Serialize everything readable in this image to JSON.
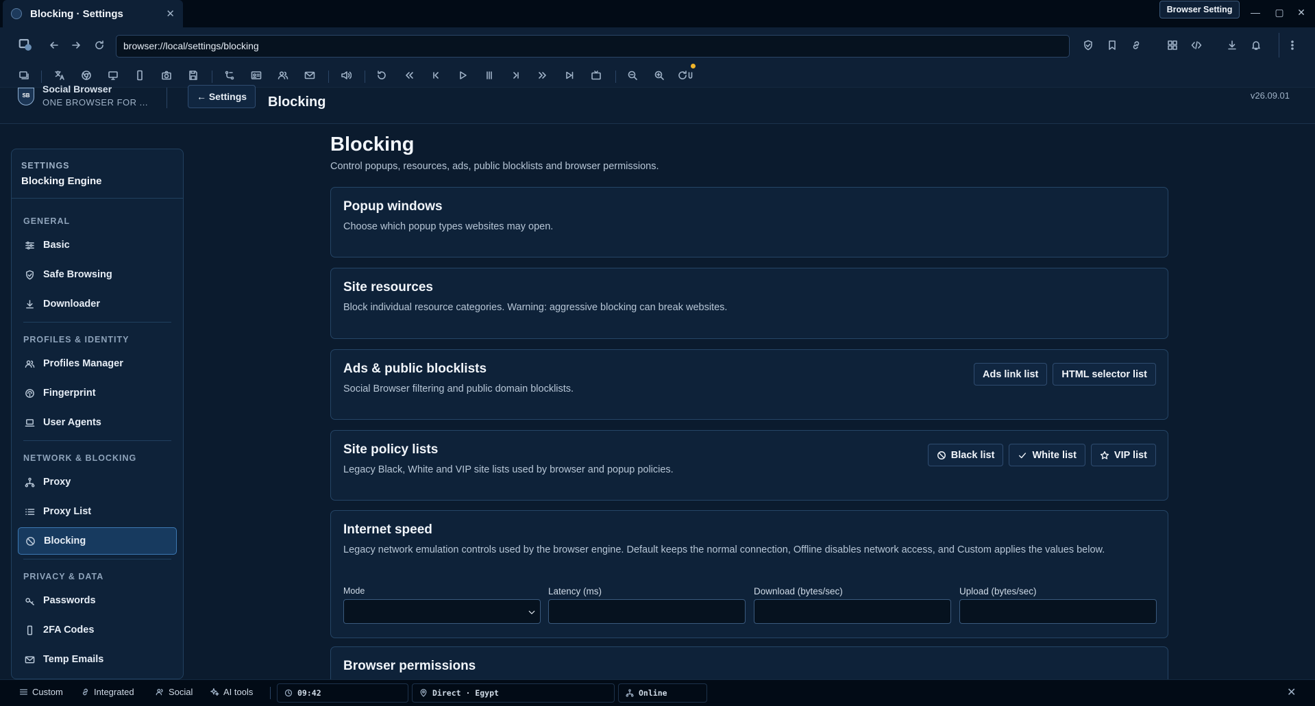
{
  "titlebar": {
    "tab_title": "Blocking · Settings",
    "tab_close": "✕",
    "browser_setting_label": "Browser Setting",
    "minimize": "—",
    "maximize": "▢",
    "close": "✕"
  },
  "navbar": {
    "url": "browser://local/settings/blocking"
  },
  "header": {
    "brand_name": "Social Browser",
    "brand_tagline": "ONE BROWSER FOR ...",
    "logo_text": "SB",
    "back_label": "← Settings",
    "title": "Blocking",
    "version": "v26.09.01"
  },
  "sidebar": {
    "kicker": "SETTINGS",
    "engine": "Blocking Engine",
    "groups": [
      {
        "title": "GENERAL",
        "items": [
          {
            "label": "Basic",
            "icon": "sliders-icon"
          },
          {
            "label": "Safe Browsing",
            "icon": "shield-icon"
          },
          {
            "label": "Downloader",
            "icon": "download-icon"
          }
        ]
      },
      {
        "title": "PROFILES & IDENTITY",
        "items": [
          {
            "label": "Profiles Manager",
            "icon": "users-icon"
          },
          {
            "label": "Fingerprint",
            "icon": "fingerprint-icon"
          },
          {
            "label": "User Agents",
            "icon": "laptop-icon"
          }
        ]
      },
      {
        "title": "NETWORK & BLOCKING",
        "items": [
          {
            "label": "Proxy",
            "icon": "network-icon"
          },
          {
            "label": "Proxy List",
            "icon": "list-icon"
          },
          {
            "label": "Blocking",
            "icon": "block-icon"
          }
        ]
      },
      {
        "title": "PRIVACY & DATA",
        "items": [
          {
            "label": "Passwords",
            "icon": "key-icon"
          },
          {
            "label": "2FA Codes",
            "icon": "phone-icon"
          },
          {
            "label": "Temp Emails",
            "icon": "mail-icon"
          }
        ]
      }
    ]
  },
  "main": {
    "title": "Blocking",
    "subtitle": "Control popups, resources, ads, public blocklists and browser permissions.",
    "cards": {
      "popup": {
        "title": "Popup windows",
        "desc": "Choose which popup types websites may open."
      },
      "resources": {
        "title": "Site resources",
        "desc": "Block individual resource categories. Warning: aggressive blocking can break websites."
      },
      "ads": {
        "title": "Ads & public blocklists",
        "desc": "Social Browser filtering and public domain blocklists.",
        "btn_ads_link": "Ads link list",
        "btn_html_selector": "HTML selector list"
      },
      "policy": {
        "title": "Site policy lists",
        "desc": "Legacy Black, White and VIP site lists used by browser and popup policies.",
        "btn_black": "Black list",
        "btn_white": "White list",
        "btn_vip": "VIP list"
      },
      "speed": {
        "title": "Internet speed",
        "desc": "Legacy network emulation controls used by the browser engine. Default keeps the normal connection, Offline disables network access, and Custom applies the values below.",
        "mode_label": "Mode",
        "latency_label": "Latency (ms)",
        "download_label": "Download (bytes/sec)",
        "upload_label": "Upload (bytes/sec)",
        "mode_value": "",
        "latency_value": "",
        "download_value": "",
        "upload_value": ""
      },
      "permissions": {
        "title": "Browser permissions"
      }
    }
  },
  "statusbar": {
    "custom": "Custom",
    "integrated": "Integrated",
    "social": "Social",
    "ai_tools": "AI tools",
    "time": "09:42",
    "connection": "Direct · Egypt",
    "online": "Online",
    "close": "✕"
  },
  "colors": {
    "background": "#0b1b2e",
    "card": "#0e2239",
    "accent": "#3d79b3",
    "active_item": "#173a5f",
    "notification_dot": "#f0b429"
  }
}
